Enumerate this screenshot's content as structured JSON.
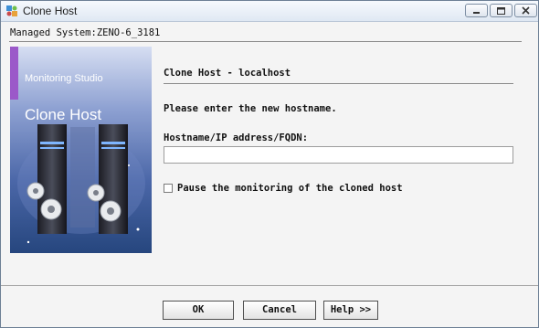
{
  "window": {
    "title": "Clone Host",
    "controls": [
      "minimize",
      "maximize",
      "close"
    ]
  },
  "managed_system": "Managed System:ZENO-6_3181",
  "side_panel": {
    "brand": "Monitoring Studio",
    "heading": "Clone Host"
  },
  "form": {
    "section_title": "Clone Host - localhost",
    "prompt": "Please enter the new hostname.",
    "hostname_label": "Hostname/IP address/FQDN:",
    "hostname_value": "",
    "pause_label": "Pause the monitoring of the cloned host",
    "pause_checked": false
  },
  "buttons": {
    "ok": "OK",
    "cancel": "Cancel",
    "help": "Help >>"
  },
  "colors": {
    "accent_bar": "#9b59c9",
    "panel_top": "#d6def2",
    "panel_bottom": "#26467e"
  }
}
